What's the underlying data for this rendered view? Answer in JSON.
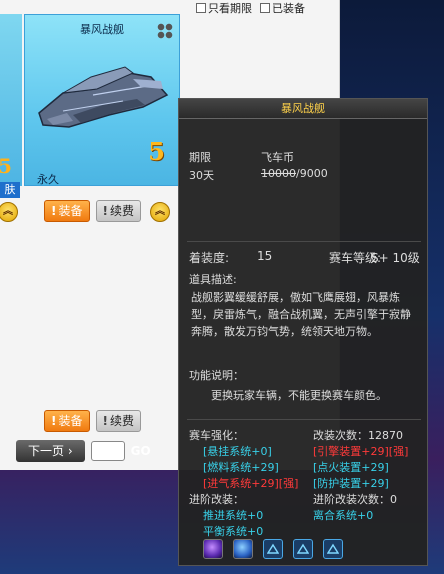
{
  "filters": {
    "only_fashion": "只看期限",
    "equipped": "已装备"
  },
  "cards": {
    "left": {
      "number": "5",
      "tag": "肤"
    },
    "main": {
      "title": "暴风战舰",
      "number": "5",
      "duration": "永久"
    }
  },
  "buttons": {
    "equip": "装备",
    "renew": "续费",
    "bang": "!"
  },
  "pager": {
    "next": "下一页 ›",
    "go": "GO"
  },
  "tooltip": {
    "title": "暴风战舰",
    "period_label": "期限",
    "currency_label": "飞车币",
    "period_value": "30天",
    "price_original": "10000",
    "price_sep": "/",
    "price_current": "9000",
    "equip_level_label": "着装度:",
    "equip_level_value": "15",
    "race_level_label": "赛车等级:",
    "race_level_value": "S+ 10级",
    "desc_label": "道具描述:",
    "desc_text": "战舰影翼缓缓舒展，傲如飞鹰展翅，风暴炼型，戾雷炼气，融合战机翼，无声引擎于寂静奔腾，散发万钧气势，统领天地万物。",
    "func_label": "功能说明：",
    "func_text": "更换玩家车辆，不能更换赛车颜色。",
    "enhance_label": "赛车强化：",
    "modify_count_label": "改装次数：",
    "modify_count_value": "12870",
    "enhance": [
      {
        "text": "[悬挂系统+0]",
        "color": "cyan"
      },
      {
        "text": "[引擎装置+29][强]",
        "color": "red"
      },
      {
        "text": "[燃料系统+29]",
        "color": "cyan"
      },
      {
        "text": "[点火装置+29]",
        "color": "cyan"
      },
      {
        "text": "[进气系统+29][强]",
        "color": "red"
      },
      {
        "text": "[防护装置+29]",
        "color": "cyan"
      }
    ],
    "advanced_label": "进阶改装：",
    "advanced_count_label": "进阶改装次数：",
    "advanced_count_value": "0",
    "advanced": [
      {
        "text": "推进系统+0"
      },
      {
        "text": "离合系统+0"
      },
      {
        "text": "平衡系统+0"
      }
    ],
    "slot_icons": [
      "purple-orb-icon",
      "blue-orb-icon",
      "triangle-slot-icon",
      "triangle-slot-icon",
      "triangle-slot-icon"
    ]
  },
  "colors": {
    "cyan": "#38d0e8",
    "red": "#ff3a3a",
    "title": "#ffd24a"
  }
}
